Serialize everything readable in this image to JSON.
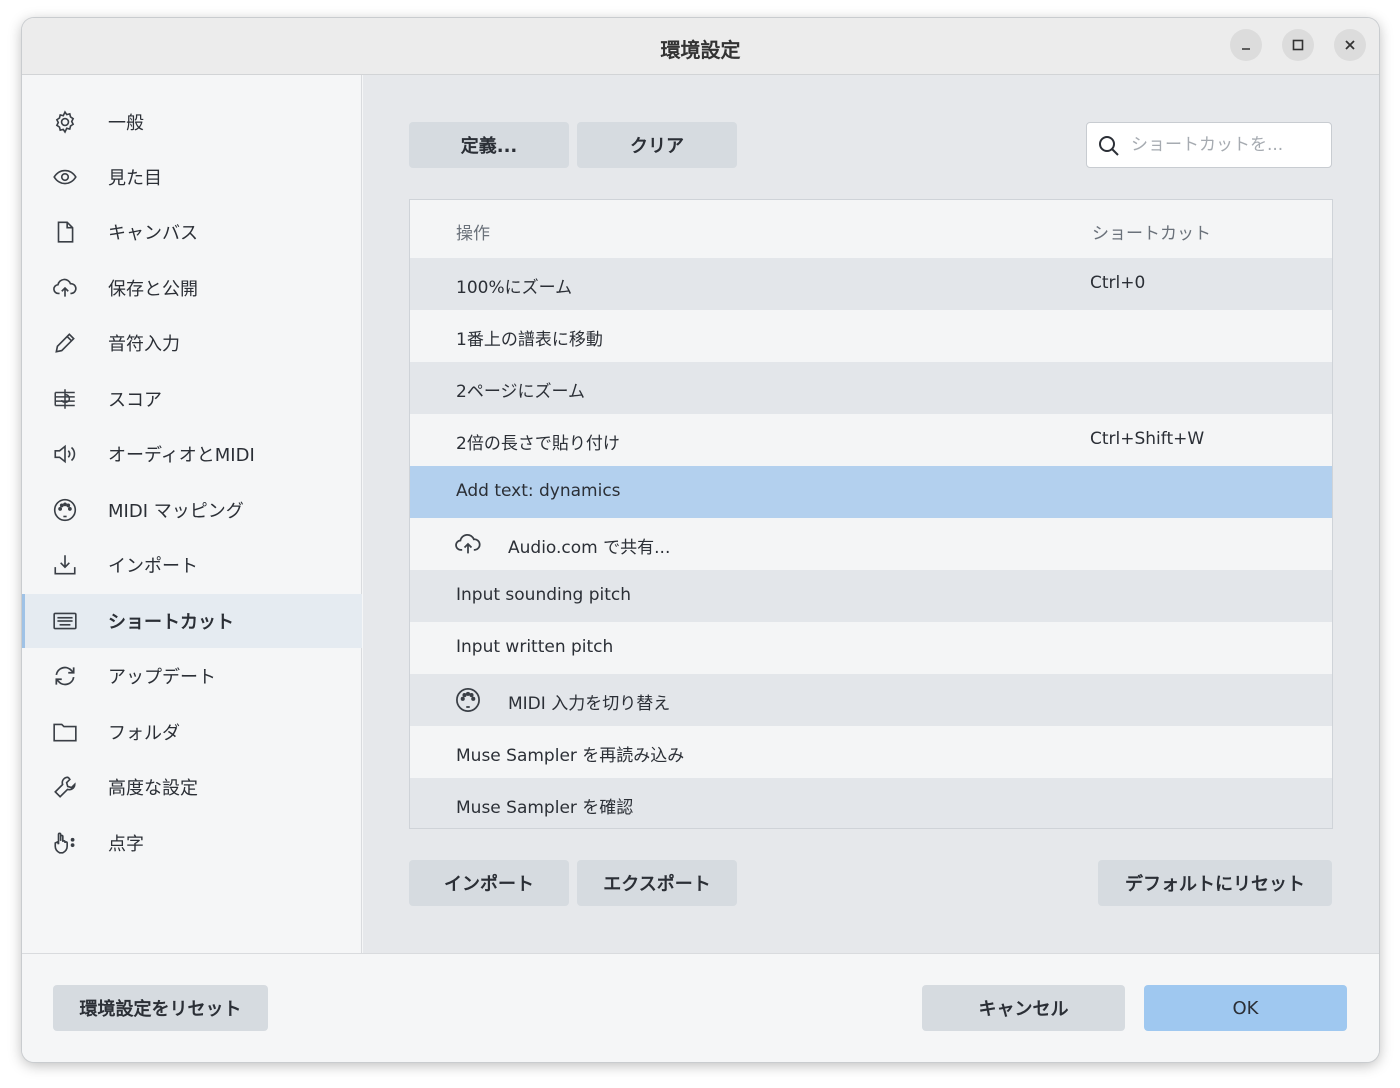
{
  "window": {
    "title": "環境設定"
  },
  "sidebar": {
    "items": [
      {
        "label": "一般",
        "icon": "gear-icon"
      },
      {
        "label": "見た目",
        "icon": "eye-icon"
      },
      {
        "label": "キャンバス",
        "icon": "page-icon"
      },
      {
        "label": "保存と公開",
        "icon": "cloud-upload-icon"
      },
      {
        "label": "音符入力",
        "icon": "pencil-icon"
      },
      {
        "label": "スコア",
        "icon": "score-icon"
      },
      {
        "label": "オーディオとMIDI",
        "icon": "speaker-icon"
      },
      {
        "label": "MIDI マッピング",
        "icon": "midi-port-icon"
      },
      {
        "label": "インポート",
        "icon": "download-icon"
      },
      {
        "label": "ショートカット",
        "icon": "keyboard-icon"
      },
      {
        "label": "アップデート",
        "icon": "refresh-icon"
      },
      {
        "label": "フォルダ",
        "icon": "folder-icon"
      },
      {
        "label": "高度な設定",
        "icon": "wrench-icon"
      },
      {
        "label": "点字",
        "icon": "braille-hand-icon"
      }
    ],
    "active_index": 9
  },
  "toolbar": {
    "define_label": "定義...",
    "clear_label": "クリア",
    "search_placeholder": "ショートカットを..."
  },
  "table": {
    "headers": {
      "action": "操作",
      "shortcut": "ショートカット"
    },
    "rows": [
      {
        "name": "100%にズーム",
        "shortcut": "Ctrl+0"
      },
      {
        "name": "1番上の譜表に移動",
        "shortcut": ""
      },
      {
        "name": "2ページにズーム",
        "shortcut": ""
      },
      {
        "name": "2倍の長さで貼り付け",
        "shortcut": "Ctrl+Shift+W"
      },
      {
        "name": "Add text: dynamics",
        "shortcut": "",
        "selected": true
      },
      {
        "name": "Audio.com で共有...",
        "shortcut": "",
        "icon": "cloud-upload-icon"
      },
      {
        "name": "Input sounding pitch",
        "shortcut": ""
      },
      {
        "name": "Input written pitch",
        "shortcut": ""
      },
      {
        "name": "MIDI 入力を切り替え",
        "shortcut": "",
        "icon": "midi-port-icon"
      },
      {
        "name": "Muse Sampler を再読み込み",
        "shortcut": ""
      },
      {
        "name": "Muse Sampler を確認",
        "shortcut": ""
      }
    ]
  },
  "bottom_actions": {
    "import_label": "インポート",
    "export_label": "エクスポート",
    "reset_default_label": "デフォルトにリセット"
  },
  "footer": {
    "reset_prefs_label": "環境設定をリセット",
    "cancel_label": "キャンセル",
    "ok_label": "OK"
  },
  "colors": {
    "selected_row": "#b3d0ee",
    "primary_button": "#9fc8f0",
    "accent_bar": "#9fc2e6"
  }
}
